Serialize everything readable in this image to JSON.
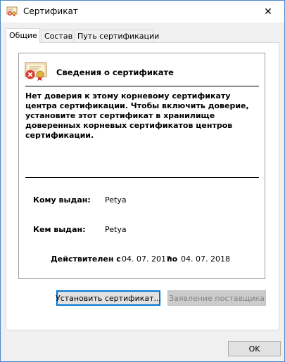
{
  "window": {
    "title": "Сертификат",
    "close_glyph": "✕"
  },
  "tabs": [
    {
      "label": "Общие",
      "active": true
    },
    {
      "label": "Состав",
      "active": false
    },
    {
      "label": "Путь сертификации",
      "active": false
    }
  ],
  "info": {
    "header": "Сведения о сертификате",
    "warning": "Нет доверия к этому корневому сертификату центра сертификации. Чтобы включить  доверие, установите этот сертификат в хранилище доверенных корневых сертификатов центров сертификации.",
    "issued_to_label": "Кому выдан:",
    "issued_to_value": "Petya",
    "issued_by_label": "Кем выдан:",
    "issued_by_value": "Petya",
    "valid_label": "Действителен с",
    "valid_from": "04. 07. 2017",
    "valid_to_label": "по",
    "valid_to": "04. 07. 2018"
  },
  "buttons": {
    "install": "Установить сертификат...",
    "statement": "Заявление поставщика",
    "ok": "OK"
  },
  "icons": {
    "title": "certificate-icon",
    "info": "certificate-error-icon",
    "close": "close-icon"
  },
  "colors": {
    "accent": "#0078d7",
    "window_border": "#4c88c9",
    "error_red": "#d83b30",
    "seal_gold": "#e0b040"
  }
}
